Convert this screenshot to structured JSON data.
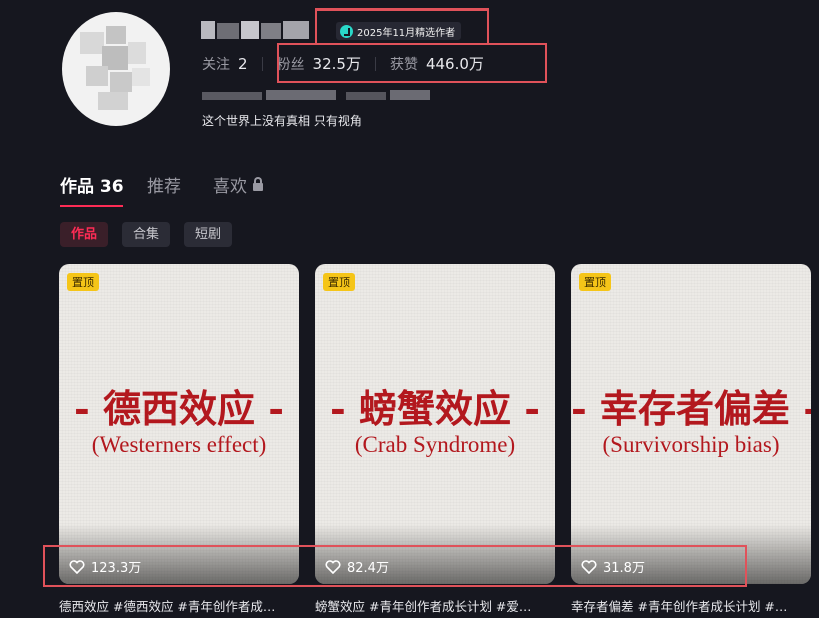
{
  "profile": {
    "badge_text": "2025年11月精选作者",
    "stats": [
      {
        "label": "关注",
        "value": "2"
      },
      {
        "label": "粉丝",
        "value": "32.5万"
      },
      {
        "label": "获赞",
        "value": "446.0万"
      }
    ],
    "bio": "这个世界上没有真相 只有视角"
  },
  "tabs": [
    {
      "label": "作品 36"
    },
    {
      "label": "推荐"
    },
    {
      "label": "喜欢"
    }
  ],
  "chips": [
    "作品",
    "合集",
    "短剧"
  ],
  "videos": [
    {
      "pin": "置顶",
      "title": "- 德西效应 -",
      "subtitle": "(Westerners effect)",
      "likes": "123.3万",
      "caption": "德西效应 #德西效应 #青年创作者成…"
    },
    {
      "pin": "置顶",
      "title": "- 螃蟹效应 -",
      "subtitle": "(Crab Syndrome)",
      "likes": "82.4万",
      "caption": "螃蟹效应 #青年创作者成长计划 #爱…"
    },
    {
      "pin": "置顶",
      "title": "- 幸存者偏差 -",
      "subtitle": "(Survivorship bias)",
      "likes": "31.8万",
      "caption": "幸存者偏差 #青年创作者成长计划 #…"
    }
  ],
  "colors": {
    "accent": "#fe2c55",
    "annotation": "#e0525a",
    "card_text": "#b3181e",
    "pin": "#f5c518"
  }
}
